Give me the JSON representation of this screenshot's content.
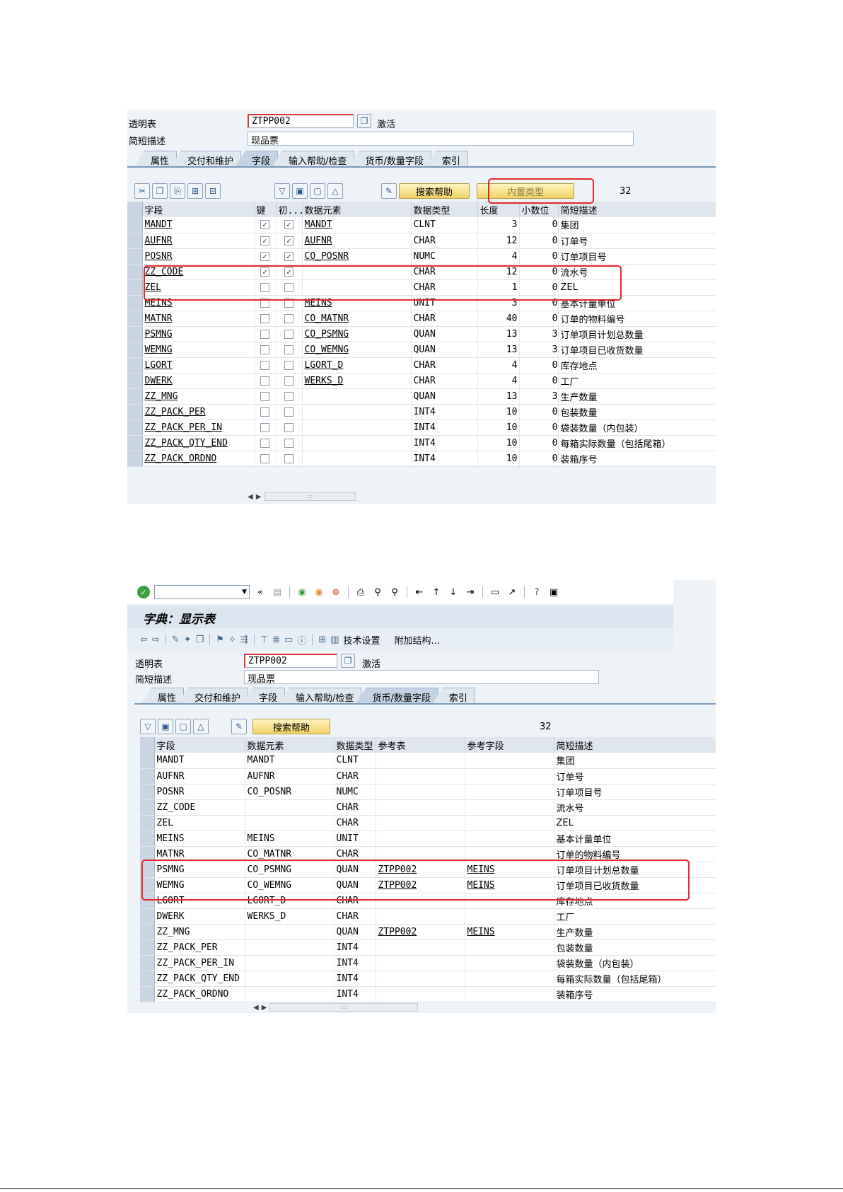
{
  "s1": {
    "table_label": "透明表",
    "table_value": "ZTPP002",
    "status": "激活",
    "desc_label": "简短描述",
    "desc_value": "现品票",
    "tabs": [
      "属性",
      "交付和维护",
      "字段",
      "输入帮助/检查",
      "货币/数量字段",
      "索引"
    ],
    "active_tab": 2,
    "btn_search_help": "搜索帮助",
    "btn_builtin_type": "内置类型",
    "count": "32",
    "columns": [
      "字段",
      "键",
      "初...",
      "数据元素",
      "数据类型",
      "长度",
      "小数位",
      "简短描述"
    ],
    "rows": [
      {
        "field": "MANDT",
        "key": true,
        "init": true,
        "elem": "MANDT",
        "type": "CLNT",
        "len": "3",
        "dec": "0",
        "desc": "集团"
      },
      {
        "field": "AUFNR",
        "key": true,
        "init": true,
        "elem": "AUFNR",
        "type": "CHAR",
        "len": "12",
        "dec": "0",
        "desc": "订单号"
      },
      {
        "field": "POSNR",
        "key": true,
        "init": true,
        "elem": "CO_POSNR",
        "type": "NUMC",
        "len": "4",
        "dec": "0",
        "desc": "订单项目号"
      },
      {
        "field": "ZZ_CODE",
        "key": true,
        "init": true,
        "elem": "",
        "type": "CHAR",
        "len": "12",
        "dec": "0",
        "desc": "流水号"
      },
      {
        "field": "ZEL",
        "key": false,
        "init": false,
        "elem": "",
        "type": "CHAR",
        "len": "1",
        "dec": "0",
        "desc": "ZEL"
      },
      {
        "field": "MEINS",
        "key": false,
        "init": false,
        "elem": "MEINS",
        "type": "UNIT",
        "len": "3",
        "dec": "0",
        "desc": "基本计量单位"
      },
      {
        "field": "MATNR",
        "key": false,
        "init": false,
        "elem": "CO_MATNR",
        "type": "CHAR",
        "len": "40",
        "dec": "0",
        "desc": "订单的物料编号"
      },
      {
        "field": "PSMNG",
        "key": false,
        "init": false,
        "elem": "CO_PSMNG",
        "type": "QUAN",
        "len": "13",
        "dec": "3",
        "desc": "订单项目计划总数量"
      },
      {
        "field": "WEMNG",
        "key": false,
        "init": false,
        "elem": "CO_WEMNG",
        "type": "QUAN",
        "len": "13",
        "dec": "3",
        "desc": "订单项目已收货数量"
      },
      {
        "field": "LGORT",
        "key": false,
        "init": false,
        "elem": "LGORT_D",
        "type": "CHAR",
        "len": "4",
        "dec": "0",
        "desc": "库存地点"
      },
      {
        "field": "DWERK",
        "key": false,
        "init": false,
        "elem": "WERKS_D",
        "type": "CHAR",
        "len": "4",
        "dec": "0",
        "desc": "工厂"
      },
      {
        "field": "ZZ_MNG",
        "key": false,
        "init": false,
        "elem": "",
        "type": "QUAN",
        "len": "13",
        "dec": "3",
        "desc": "生产数量"
      },
      {
        "field": "ZZ_PACK_PER",
        "key": false,
        "init": false,
        "elem": "",
        "type": "INT4",
        "len": "10",
        "dec": "0",
        "desc": "包装数量"
      },
      {
        "field": "ZZ_PACK_PER_IN",
        "key": false,
        "init": false,
        "elem": "",
        "type": "INT4",
        "len": "10",
        "dec": "0",
        "desc": "袋装数量（内包装）"
      },
      {
        "field": "ZZ_PACK_QTY_END",
        "key": false,
        "init": false,
        "elem": "",
        "type": "INT4",
        "len": "10",
        "dec": "0",
        "desc": "每箱实际数量（包括尾箱）"
      },
      {
        "field": "ZZ_PACK_ORDNO",
        "key": false,
        "init": false,
        "elem": "",
        "type": "INT4",
        "len": "10",
        "dec": "0",
        "desc": "装箱序号"
      }
    ]
  },
  "s2": {
    "title": "字典：显示表",
    "tech_settings": "技术设置",
    "append_struct": "附加结构...",
    "table_label": "透明表",
    "table_value": "ZTPP002",
    "status": "激活",
    "desc_label": "简短描述",
    "desc_value": "现品票",
    "tabs": [
      "属性",
      "交付和维护",
      "字段",
      "输入帮助/检查",
      "货币/数量字段",
      "索引"
    ],
    "active_tab": 4,
    "btn_search_help": "搜索帮助",
    "count": "32",
    "columns": [
      "字段",
      "数据元素",
      "数据类型",
      "参考表",
      "参考字段",
      "简短描述"
    ],
    "rows": [
      {
        "field": "MANDT",
        "elem": "MANDT",
        "type": "CLNT",
        "reftab": "",
        "reffield": "",
        "desc": "集团"
      },
      {
        "field": "AUFNR",
        "elem": "AUFNR",
        "type": "CHAR",
        "reftab": "",
        "reffield": "",
        "desc": "订单号"
      },
      {
        "field": "POSNR",
        "elem": "CO_POSNR",
        "type": "NUMC",
        "reftab": "",
        "reffield": "",
        "desc": "订单项目号"
      },
      {
        "field": "ZZ_CODE",
        "elem": "",
        "type": "CHAR",
        "reftab": "",
        "reffield": "",
        "desc": "流水号"
      },
      {
        "field": "ZEL",
        "elem": "",
        "type": "CHAR",
        "reftab": "",
        "reffield": "",
        "desc": "ZEL"
      },
      {
        "field": "MEINS",
        "elem": "MEINS",
        "type": "UNIT",
        "reftab": "",
        "reffield": "",
        "desc": "基本计量单位"
      },
      {
        "field": "MATNR",
        "elem": "CO_MATNR",
        "type": "CHAR",
        "reftab": "",
        "reffield": "",
        "desc": "订单的物料编号"
      },
      {
        "field": "PSMNG",
        "elem": "CO_PSMNG",
        "type": "QUAN",
        "reftab": "ZTPP002",
        "reffield": "MEINS",
        "desc": "订单项目计划总数量"
      },
      {
        "field": "WEMNG",
        "elem": "CO_WEMNG",
        "type": "QUAN",
        "reftab": "ZTPP002",
        "reffield": "MEINS",
        "desc": "订单项目已收货数量"
      },
      {
        "field": "LGORT",
        "elem": "LGORT_D",
        "type": "CHAR",
        "reftab": "",
        "reffield": "",
        "desc": "库存地点"
      },
      {
        "field": "DWERK",
        "elem": "WERKS_D",
        "type": "CHAR",
        "reftab": "",
        "reffield": "",
        "desc": "工厂"
      },
      {
        "field": "ZZ_MNG",
        "elem": "",
        "type": "QUAN",
        "reftab": "ZTPP002",
        "reffield": "MEINS",
        "desc": "生产数量"
      },
      {
        "field": "ZZ_PACK_PER",
        "elem": "",
        "type": "INT4",
        "reftab": "",
        "reffield": "",
        "desc": "包装数量"
      },
      {
        "field": "ZZ_PACK_PER_IN",
        "elem": "",
        "type": "INT4",
        "reftab": "",
        "reffield": "",
        "desc": "袋装数量（内包装）"
      },
      {
        "field": "ZZ_PACK_QTY_END",
        "elem": "",
        "type": "INT4",
        "reftab": "",
        "reffield": "",
        "desc": "每箱实际数量（包括尾箱）"
      },
      {
        "field": "ZZ_PACK_ORDNO",
        "elem": "",
        "type": "INT4",
        "reftab": "",
        "reffield": "",
        "desc": "装箱序号"
      }
    ]
  },
  "colors": {
    "highlight_box": "#e8262b",
    "panel_bg": "#eef3f8",
    "button_yellow": "#f2d266"
  }
}
